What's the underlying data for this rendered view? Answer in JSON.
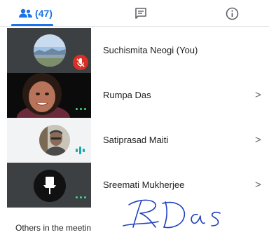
{
  "tabs": {
    "people": {
      "icon": "people-icon",
      "count": "(47)"
    },
    "chat": {
      "icon": "chat-icon"
    },
    "info": {
      "icon": "info-icon"
    }
  },
  "participants": [
    {
      "name": "Suchismita Neogi (You)",
      "tile": "landscape-photo",
      "status": "mic-off-icon"
    },
    {
      "name": "Rumpa Das",
      "tile": "webcam-video",
      "status": "more-dots-icon",
      "chevron": ">"
    },
    {
      "name": "Satiprasad Maiti",
      "tile": "profile-photo",
      "status": "speaking-audio-icon",
      "chevron": ">"
    },
    {
      "name": "Sreemati Mukherjee",
      "tile": "pin-avatar",
      "status": "more-dots-icon",
      "chevron": ">"
    }
  ],
  "others_heading": "Others in the meetin",
  "colors": {
    "accent": "#1a73e8",
    "mic_off": "#d93025",
    "dots": "#3ddc84",
    "speaking": "#1ea7a7",
    "signature_ink": "#1f3fbf"
  }
}
